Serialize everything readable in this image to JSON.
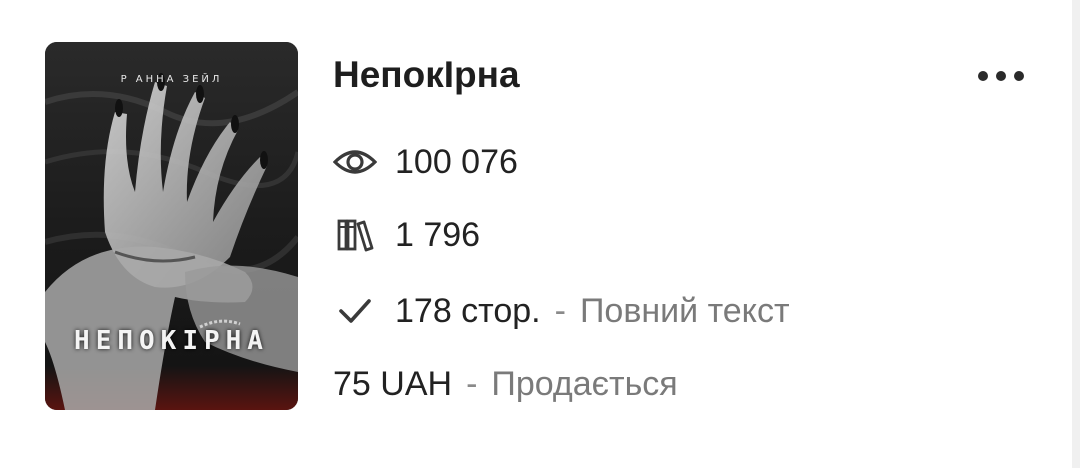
{
  "book": {
    "title": "НепокІрна",
    "cover": {
      "author": "Р АННА ЗЕЙЛ",
      "title": "НЕПОКІРНА"
    },
    "views": "100 076",
    "library_adds": "1 796",
    "pages": "178 стор.",
    "pages_separator": "-",
    "status": "Повний текст",
    "price": "75 UAH",
    "price_separator": "-",
    "sale_status": "Продається"
  },
  "icons": {
    "views": "eye-icon",
    "library": "books-icon",
    "pages": "checkmark-icon",
    "menu": "more-dots-icon"
  },
  "colors": {
    "text": "#222222",
    "muted": "#7a7a7a",
    "background": "#ffffff"
  }
}
